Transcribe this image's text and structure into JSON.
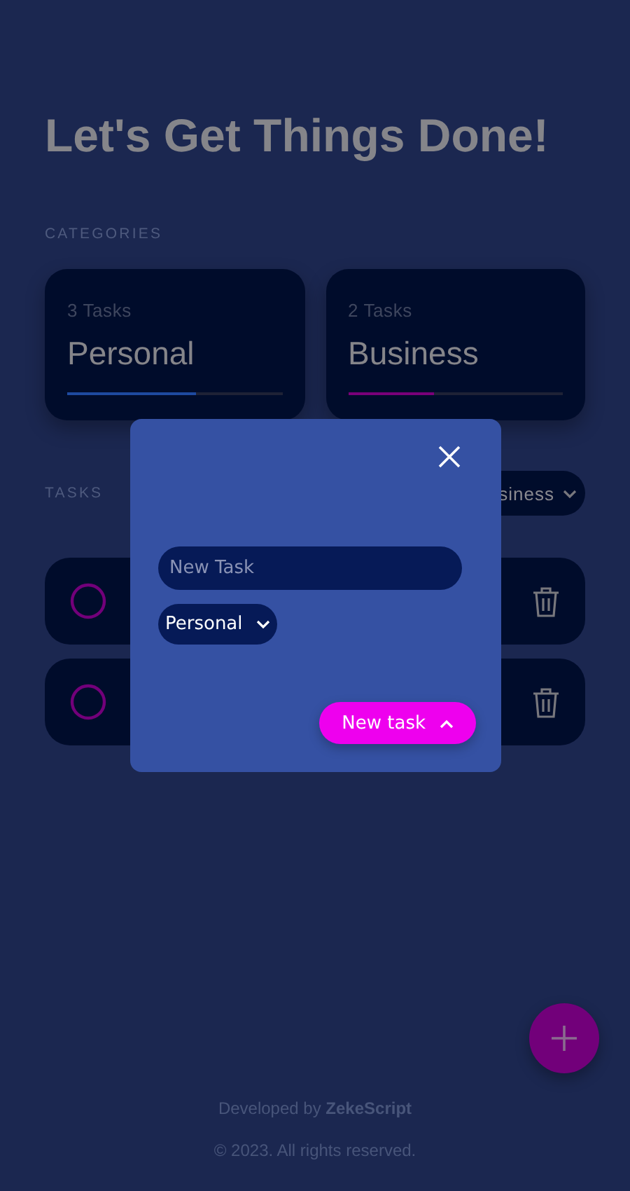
{
  "title": "Let's Get Things Done!",
  "categories_label": "CATEGORIES",
  "categories": [
    {
      "count": "3 Tasks",
      "name": "Personal",
      "level": 0.6,
      "color": "#1e4aa0"
    },
    {
      "count": "2 Tasks",
      "name": "Business",
      "level": 0.4,
      "color": "#7a007a"
    }
  ],
  "tasks_label": "TASKS",
  "filter": {
    "value": "siness"
  },
  "tasks": [
    {
      "done": false
    },
    {
      "done": false
    }
  ],
  "modal": {
    "input": {
      "placeholder": "New Task"
    },
    "category_select": {
      "value": "Personal"
    },
    "submit": "New task"
  },
  "footer": {
    "credit": "Developed by **ZekeScript**",
    "copyright": "© 2023. All rights reserved."
  }
}
